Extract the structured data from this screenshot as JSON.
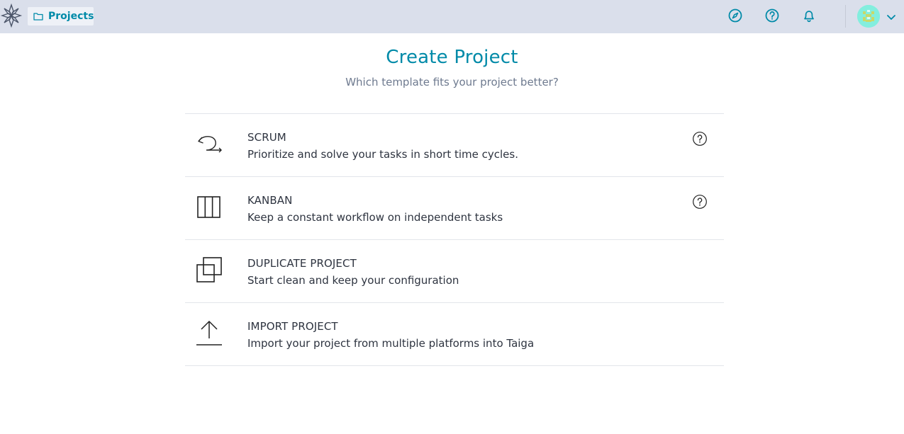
{
  "header": {
    "logo_icon": "taiga-logo-icon",
    "projects_label": "Projects",
    "icons": [
      "discover-compass-icon",
      "help-question-icon",
      "notifications-bell-icon"
    ],
    "avatar_icon": "user-avatar",
    "menu_icon": "chevron-down-icon",
    "accent": "#008aa8",
    "bar_color": "#dadfeb"
  },
  "main": {
    "title": "Create Project",
    "subtitle": "Which template fits your project better?"
  },
  "options": [
    {
      "title": "SCRUM",
      "description": "Prioritize and solve your tasks in short time cycles.",
      "icon": "scrum-cycle-icon",
      "help": true
    },
    {
      "title": "KANBAN",
      "description": "Keep a constant workflow on independent tasks",
      "icon": "kanban-columns-icon",
      "help": true
    },
    {
      "title": "DUPLICATE PROJECT",
      "description": "Start clean and keep your configuration",
      "icon": "duplicate-icon",
      "help": false
    },
    {
      "title": "IMPORT PROJECT",
      "description": "Import your project from multiple platforms into Taiga",
      "icon": "upload-icon",
      "help": false
    }
  ]
}
